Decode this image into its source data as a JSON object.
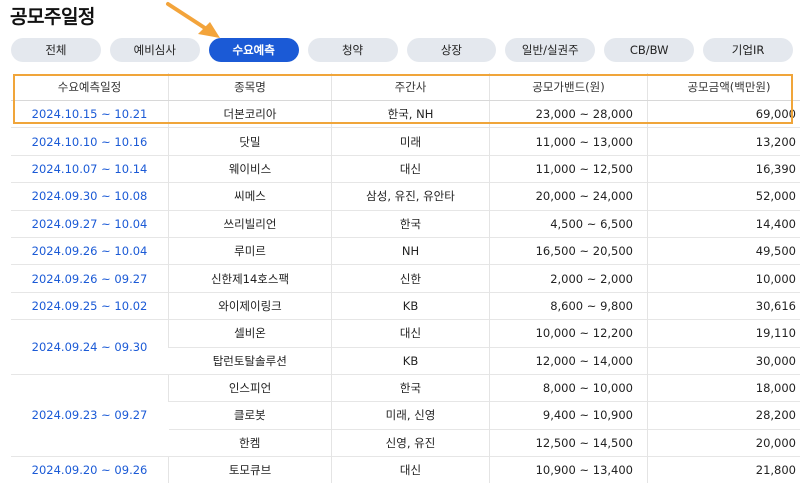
{
  "page_title": "공모주일정",
  "tabs": [
    {
      "label": "전체",
      "active": false
    },
    {
      "label": "예비심사",
      "active": false
    },
    {
      "label": "수요예측",
      "active": true
    },
    {
      "label": "청약",
      "active": false
    },
    {
      "label": "상장",
      "active": false
    },
    {
      "label": "일반/실권주",
      "active": false
    },
    {
      "label": "CB/BW",
      "active": false
    },
    {
      "label": "기업IR",
      "active": false
    }
  ],
  "colors": {
    "accent": "#1b5ad6",
    "highlight": "#f0a53a",
    "arrow": "#f3a43b"
  },
  "table": {
    "headers": [
      "수요예측일정",
      "종목명",
      "주간사",
      "공모가밴드(원)",
      "공모금액(백만원)"
    ],
    "rows": [
      {
        "date": "2024.10.15 ~ 10.21",
        "name": "더본코리아",
        "underwriter": "한국, NH",
        "band": "23,000 ~ 28,000",
        "amount": "69,000"
      },
      {
        "date": "2024.10.10 ~ 10.16",
        "name": "닷밀",
        "underwriter": "미래",
        "band": "11,000 ~ 13,000",
        "amount": "13,200"
      },
      {
        "date": "2024.10.07 ~ 10.14",
        "name": "웨이비스",
        "underwriter": "대신",
        "band": "11,000 ~ 12,500",
        "amount": "16,390"
      },
      {
        "date": "2024.09.30 ~ 10.08",
        "name": "씨메스",
        "underwriter": "삼성, 유진, 유안타",
        "band": "20,000 ~ 24,000",
        "amount": "52,000"
      },
      {
        "date": "2024.09.27 ~ 10.04",
        "name": "쓰리빌리언",
        "underwriter": "한국",
        "band": "4,500 ~ 6,500",
        "amount": "14,400"
      },
      {
        "date": "2024.09.26 ~ 10.04",
        "name": "루미르",
        "underwriter": "NH",
        "band": "16,500 ~ 20,500",
        "amount": "49,500"
      },
      {
        "date": "2024.09.26 ~ 09.27",
        "name": "신한제14호스팩",
        "underwriter": "신한",
        "band": "2,000 ~ 2,000",
        "amount": "10,000"
      },
      {
        "date": "2024.09.25 ~ 10.02",
        "name": "와이제이링크",
        "underwriter": "KB",
        "band": "8,600 ~ 9,800",
        "amount": "30,616"
      },
      {
        "date": "2024.09.24 ~ 09.30",
        "name": "셀비온",
        "underwriter": "대신",
        "band": "10,000 ~ 12,200",
        "amount": "19,110"
      },
      {
        "date": "",
        "name": "탑런토탈솔루션",
        "underwriter": "KB",
        "band": "12,000 ~ 14,000",
        "amount": "30,000"
      },
      {
        "date": "2024.09.23 ~ 09.27",
        "name": "인스피언",
        "underwriter": "한국",
        "band": "8,000 ~ 10,000",
        "amount": "18,000"
      },
      {
        "date": "",
        "name": "클로봇",
        "underwriter": "미래, 신영",
        "band": "9,400 ~ 10,900",
        "amount": "28,200"
      },
      {
        "date": "",
        "name": "한켐",
        "underwriter": "신영, 유진",
        "band": "12,500 ~ 14,500",
        "amount": "20,000"
      },
      {
        "date": "2024.09.20 ~ 09.26",
        "name": "토모큐브",
        "underwriter": "대신",
        "band": "10,900 ~ 13,400",
        "amount": "21,800"
      }
    ]
  }
}
